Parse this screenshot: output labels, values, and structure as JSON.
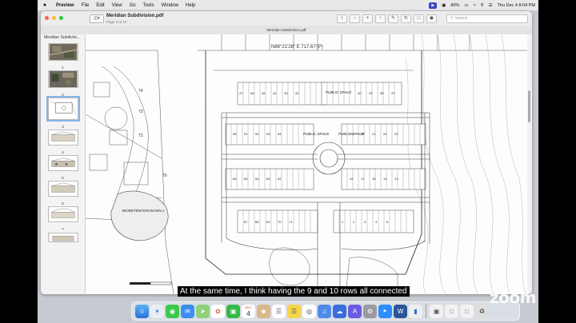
{
  "menubar": {
    "apple": "",
    "app": "Preview",
    "items": [
      "File",
      "Edit",
      "View",
      "Go",
      "Tools",
      "Window",
      "Help"
    ],
    "battery": "80%",
    "clock": "Thu Dec 4  8:04 PM"
  },
  "window": {
    "title": "Meridian Subdivision.pdf",
    "subtitle": "Page 3 of 10",
    "tab_title": "Meridian Subdivision.pdf",
    "search_placeholder": "Search"
  },
  "sidebar": {
    "title": "Meridian Subdivisi...",
    "pages": [
      "1",
      "2",
      "3",
      "4",
      "5",
      "6",
      "7"
    ]
  },
  "plan": {
    "bearing": "N88°21'28\" E  717.67'(P)",
    "public_space_labels": [
      "PUBLIC SPACE",
      "PUBLIC SPACE",
      "PUBLIC SPACE"
    ],
    "lot_70": "70",
    "lot_72": "72",
    "lot_73": "73",
    "lot_74": "74",
    "bioretention": "BIORETENTION BASIN A",
    "lots_row1": [
      "47",
      "46",
      "45",
      "44",
      "43",
      "42",
      "41",
      "40",
      "39",
      "38",
      "37",
      "36",
      "35",
      "34",
      "33"
    ],
    "lots_row2": [
      "55",
      "56",
      "51",
      "52",
      "53",
      "54",
      "55",
      "56",
      "57",
      "58",
      "19",
      "20",
      "21",
      "22",
      "23",
      "24",
      "25",
      "26",
      "27",
      "28"
    ],
    "lots_row3": [
      "66",
      "65",
      "64",
      "63",
      "62",
      "61",
      "60",
      "59",
      "15",
      "17",
      "16",
      "14",
      "13",
      "12",
      "11",
      "10",
      "9"
    ],
    "lots_row4": [
      "67",
      "68",
      "69",
      "70",
      "71",
      "72",
      "73",
      "74",
      "1",
      "2",
      "3",
      "4",
      "5",
      "6",
      "7",
      "8"
    ]
  },
  "caption": "At the same time, I think having the 9 and 10 rows all connected",
  "zoom_watermark": "zoom",
  "dock": {
    "calendar_month": "DEC",
    "calendar_day": "4",
    "items": [
      "finder-icon",
      "safari-icon",
      "messages-icon",
      "mail-icon",
      "maps-icon",
      "photos-icon",
      "facetime-icon",
      "calendar-icon",
      "contacts-icon",
      "reminders-icon",
      "notes-icon",
      "chrome-icon",
      "music-icon",
      "podcasts-icon",
      "appstore-icon",
      "settings-icon",
      "zoom-icon",
      "word-icon",
      "keynote-icon",
      "preview-icon"
    ]
  }
}
